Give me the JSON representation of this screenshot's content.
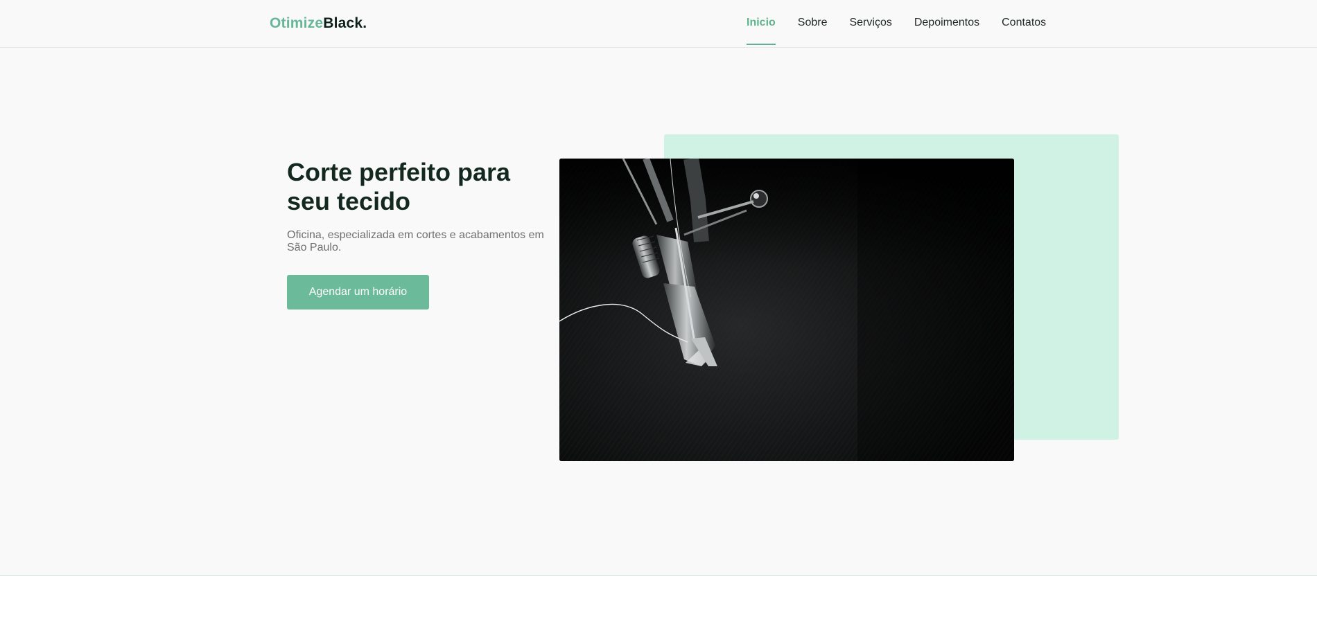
{
  "brand": {
    "name_part1": "Otimize",
    "name_part2": "Black."
  },
  "nav": {
    "items": [
      {
        "label": "Inicio",
        "active": true
      },
      {
        "label": "Sobre",
        "active": false
      },
      {
        "label": "Serviços",
        "active": false
      },
      {
        "label": "Depoimentos",
        "active": false
      },
      {
        "label": "Contatos",
        "active": false
      }
    ]
  },
  "hero": {
    "title": "Corte perfeito para seu tecido",
    "subtitle": "Oficina, especializada em cortes e acabamentos em São Paulo.",
    "cta_label": "Agendar um horário"
  },
  "colors": {
    "accent": "#66b798",
    "mint": "#cff2e4",
    "dark": "#13281f",
    "background": "#f9f9f9"
  }
}
